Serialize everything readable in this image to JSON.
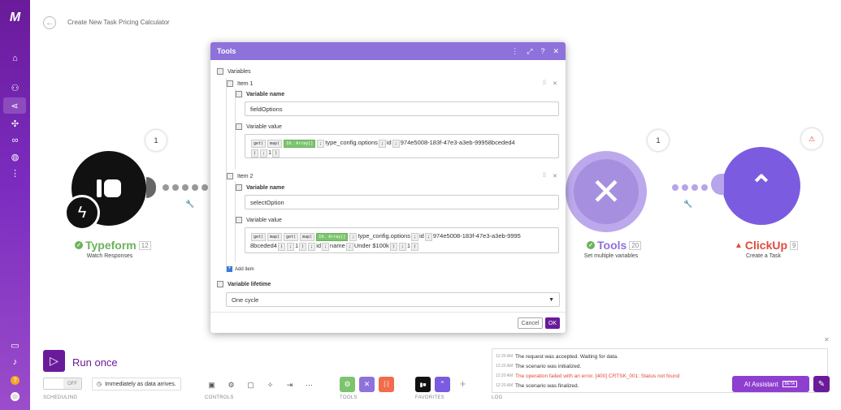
{
  "app": {
    "title": "Create New Task Pricing Calculator",
    "logo": "M"
  },
  "sidebar": {
    "items": [
      "home-icon",
      "users-icon",
      "share-icon",
      "puzzle-icon",
      "link-icon",
      "globe-icon",
      "more-icon",
      "book-icon",
      "bell-icon",
      "help-icon",
      "avatar-icon"
    ]
  },
  "modules": {
    "typeform": {
      "name": "Typeform",
      "number": "12",
      "sub": "Watch Responses",
      "bubble": "1"
    },
    "tools": {
      "name": "Tools",
      "number": "20",
      "sub": "Set multiple variables",
      "bubble": "1"
    },
    "clickup": {
      "name": "ClickUp",
      "number": "9",
      "sub": "Create a Task",
      "bubble": "⚠"
    }
  },
  "modal": {
    "title": "Tools",
    "variables_label": "Variables",
    "items": [
      {
        "label": "Item 1",
        "name_label": "Variable name",
        "name_value": "fieldOptions",
        "value_label": "Variable value",
        "value_line1": [
          "get(",
          "map(",
          "19. Array[]",
          ";",
          "type_config.options",
          ";",
          "id",
          ";",
          "974e5008-183f-47e3-a3eb-99958bceded4"
        ],
        "value_line2": [
          ")",
          ";",
          "1",
          ")"
        ]
      },
      {
        "label": "Item 2",
        "name_label": "Variable name",
        "name_value": "selectOption",
        "value_label": "Variable value",
        "value_line1": [
          "get(",
          "map(",
          "get(",
          "map(",
          "19. Array[]",
          ";",
          "type_config.options",
          ";",
          "id",
          ";",
          "974e5008-183f-47e3-a3eb-9995"
        ],
        "value_line2": [
          "8bceded4",
          ")",
          ";",
          "1",
          ")",
          ";",
          "id",
          ";",
          "name",
          ";",
          "Under $100k",
          ")",
          ";",
          "1",
          ")"
        ]
      }
    ],
    "add_item": "Add item",
    "lifetime_label": "Variable lifetime",
    "lifetime_value": "One cycle",
    "cancel": "Cancel",
    "ok": "OK"
  },
  "bottom": {
    "run_once": "Run once",
    "toggle": "OFF",
    "schedule_text": "Immediately as data arrives.",
    "sections": {
      "scheduling": "SCHEDULING",
      "controls": "CONTROLS",
      "tools": "TOOLS",
      "favorites": "FAVORITES",
      "log": "LOG"
    },
    "ai_assistant": "AI Assistant",
    "beta": "BETA"
  },
  "log": [
    {
      "time": "12:20 AM",
      "text": "The request was accepted. Waiting for data.",
      "color": "#333"
    },
    {
      "time": "12:20 AM",
      "text": "The scenario was initialized.",
      "color": "#333"
    },
    {
      "time": "12:20 AM",
      "text": "The operation failed with an error. [400] CRTSK_001: Status not found",
      "color": "#e04a3a"
    },
    {
      "time": "12:20 AM",
      "text": "The scenario was finalized.",
      "color": "#333"
    }
  ],
  "colors": {
    "purple": "#6a1b9a",
    "accent": "#8e72db",
    "tools": "#a78fe0",
    "clickup": "#7b5ce0",
    "green": "#7cc46f",
    "error": "#e04a3a"
  }
}
